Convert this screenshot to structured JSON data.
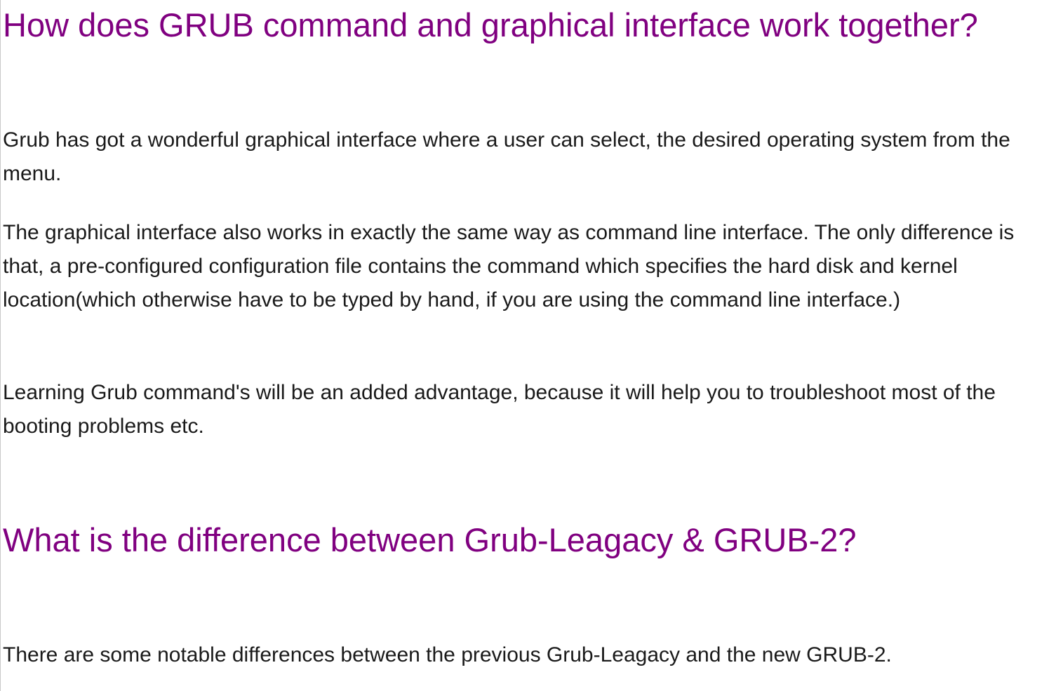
{
  "sections": [
    {
      "heading": "How does GRUB command and graphical interface work together?",
      "paragraphs": [
        "Grub has got a wonderful graphical interface where a user can select, the desired operating system from the menu.",
        "The graphical interface also works in exactly the same way as command line interface. The only difference is that, a pre-configured configuration file contains the command which specifies the hard disk and kernel location(which otherwise have to be typed by hand, if you are using the command line interface.)",
        "Learning Grub command's will be an added advantage, because it will help you to troubleshoot most of the booting problems etc."
      ]
    },
    {
      "heading": "What is the difference between Grub-Leagacy & GRUB-2?",
      "paragraphs": [
        "There are some notable differences between the previous Grub-Leagacy and the new GRUB-2."
      ]
    }
  ],
  "colors": {
    "heading": "#800080",
    "text": "#1a1a1a",
    "background": "#ffffff"
  }
}
